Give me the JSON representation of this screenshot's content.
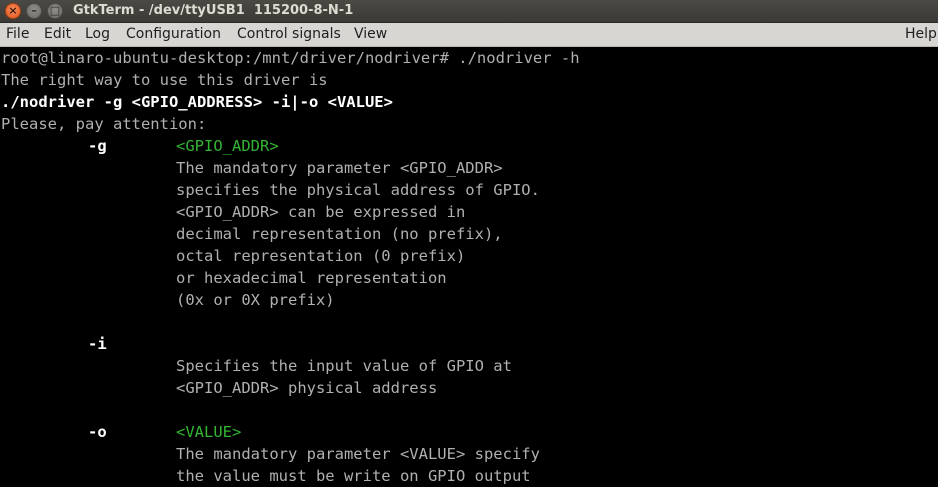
{
  "window": {
    "title": "GtkTerm - /dev/ttyUSB1  115200-8-N-1",
    "close_glyph": "×",
    "min_glyph": "–",
    "max_glyph": "□"
  },
  "menubar": {
    "file": "File",
    "edit": "Edit",
    "log": "Log",
    "configuration": "Configuration",
    "control_signals": "Control signals",
    "view": "View",
    "help": "Help"
  },
  "terminal": {
    "prompt_line": "root@linaro-ubuntu-desktop:/mnt/driver/nodriver# ./nodriver -h",
    "usage_intro": "The right way to use this driver is",
    "usage_cmd": "./nodriver -g <GPIO_ADDRESS> -i|-o <VALUE>",
    "attention": "Please, pay attention:",
    "opt_g": {
      "flag": "-g",
      "arg": "<GPIO_ADDR>",
      "desc": [
        "The mandatory parameter <GPIO_ADDR>",
        "specifies the physical address of GPIO.",
        "<GPIO_ADDR> can be expressed in",
        "decimal representation (no prefix),",
        "octal representation (0 prefix)",
        "or hexadecimal representation",
        "(0x or 0X prefix)"
      ]
    },
    "opt_i": {
      "flag": "-i",
      "desc": [
        "Specifies the input value of GPIO at",
        "<GPIO_ADDR> physical address"
      ]
    },
    "opt_o": {
      "flag": "-o",
      "arg": "<VALUE>",
      "desc": [
        "The mandatory parameter <VALUE> specify",
        "the value must be write on GPIO output"
      ]
    }
  }
}
